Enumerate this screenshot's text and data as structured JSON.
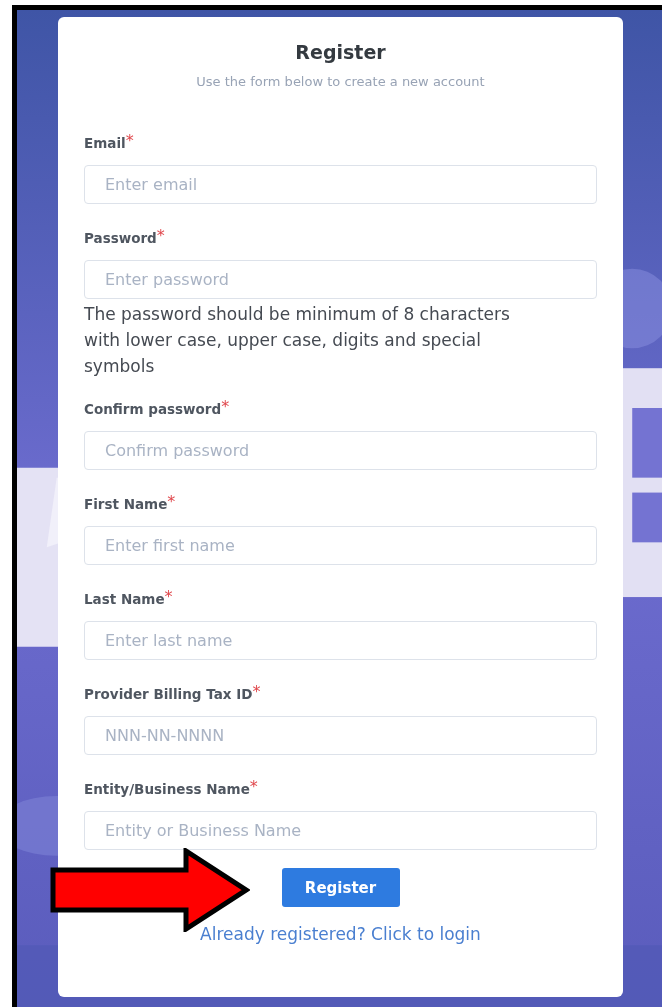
{
  "title": "Register",
  "subtitle": "Use the form below to create a new account",
  "fields": [
    {
      "label": "Email",
      "required_mark": "*",
      "placeholder": "Enter email"
    },
    {
      "label": "Password",
      "required_mark": "*",
      "placeholder": "Enter password",
      "hint": "The password should be minimum of 8 characters with lower case, upper case, digits and special symbols"
    },
    {
      "label": "Confirm password",
      "required_mark": "*",
      "placeholder": "Confirm password"
    },
    {
      "label": "First Name",
      "required_mark": "*",
      "placeholder": "Enter first name"
    },
    {
      "label": "Last Name",
      "required_mark": "*",
      "placeholder": "Enter last name"
    },
    {
      "label": "Provider Billing Tax ID",
      "required_mark": "*",
      "placeholder": "NNN-NN-NNNN"
    },
    {
      "label": "Entity/Business Name",
      "required_mark": "*",
      "placeholder": "Entity or Business Name"
    }
  ],
  "submit_button": "Register",
  "login_link": "Already registered? Click to login"
}
